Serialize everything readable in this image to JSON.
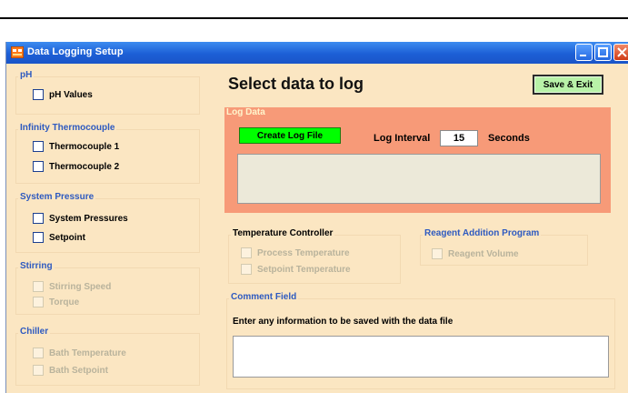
{
  "window": {
    "title": "Data Logging Setup"
  },
  "heading": "Select data to log",
  "save_label": "Save & Exit",
  "left_groups": {
    "ph": {
      "title": "pH",
      "items": [
        {
          "label": "pH Values"
        }
      ]
    },
    "thermo": {
      "title": "Infinity Thermocouple",
      "items": [
        {
          "label": "Thermocouple 1"
        },
        {
          "label": "Thermocouple 2"
        }
      ]
    },
    "pressure": {
      "title": "System Pressure",
      "items": [
        {
          "label": "System Pressures"
        },
        {
          "label": "Setpoint"
        }
      ]
    },
    "stirring": {
      "title": "Stirring",
      "items": [
        {
          "label": "Stirring Speed"
        },
        {
          "label": "Torque"
        }
      ]
    },
    "chiller": {
      "title": "Chiller",
      "items": [
        {
          "label": "Bath Temperature"
        },
        {
          "label": "Bath Setpoint"
        }
      ]
    }
  },
  "log": {
    "title": "Log Data",
    "create_label": "Create Log File",
    "interval_label": "Log Interval",
    "interval_value": "15",
    "interval_units": "Seconds"
  },
  "temp_controller": {
    "title": "Temperature Controller",
    "items": [
      {
        "label": "Process Temperature"
      },
      {
        "label": "Setpoint Temperature"
      }
    ]
  },
  "reagent": {
    "title": "Reagent Addition Program",
    "items": [
      {
        "label": "Reagent Volume"
      }
    ]
  },
  "comment": {
    "title": "Comment Field",
    "prompt": "Enter any information to be saved with the data file",
    "value": ""
  },
  "colors": {
    "window_bg": "#fbe6c2",
    "log_panel": "#f79a78",
    "save_button": "#b8f2a8",
    "create_button": "#00ff00",
    "titlebar": "#1c5fd6",
    "group_title": "#2e5ac0"
  },
  "icons": {
    "app": "data-logging-app-icon",
    "minimize": "minimize-icon",
    "maximize": "maximize-icon",
    "close": "close-icon"
  }
}
